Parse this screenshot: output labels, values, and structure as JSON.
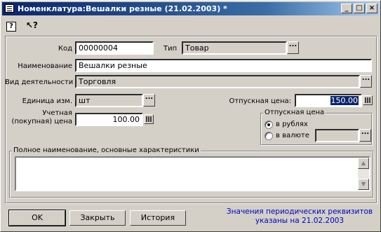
{
  "window": {
    "title": "Номенклатура:Вешалки резные (21.02.2003) *",
    "controls": {
      "minimize": "_",
      "maximize": "□",
      "close": "×"
    }
  },
  "toolbar": {
    "help_label": "?",
    "whats_this_label": "↖?"
  },
  "form": {
    "code_label": "Код",
    "code_value": "00000004",
    "type_label": "Тип",
    "type_value": "Товар",
    "name_label": "Наименование",
    "name_value": "Вешалки резные",
    "activity_label": "Вид деятельности",
    "activity_value": "Торговля",
    "unit_label": "Единица изм.",
    "unit_value": "шт",
    "sale_price_label": "Отпускная цена:",
    "sale_price_value": "150.00",
    "account_price_label_1": "Учетная",
    "account_price_label_2": "(покупная) цена",
    "account_price_value": "100.00",
    "price_group": {
      "title": "Отпускная цена",
      "options": [
        "в рублях",
        "в валюте"
      ],
      "selected": "в рублях",
      "currency_value": ""
    },
    "dots_label": "...",
    "full_name_group_title": "Полное наименование, основные характеристики",
    "full_name_value": ""
  },
  "buttons": {
    "ok": "OK",
    "close": "Закрыть",
    "history": "История"
  },
  "note": "Значения периодических реквизитов указаны на 21.02.2003",
  "colors": {
    "title_gradient_start": "#0a246a",
    "title_gradient_end": "#a6caf0",
    "note_text": "#0000c0",
    "face": "#d4d0c8"
  }
}
